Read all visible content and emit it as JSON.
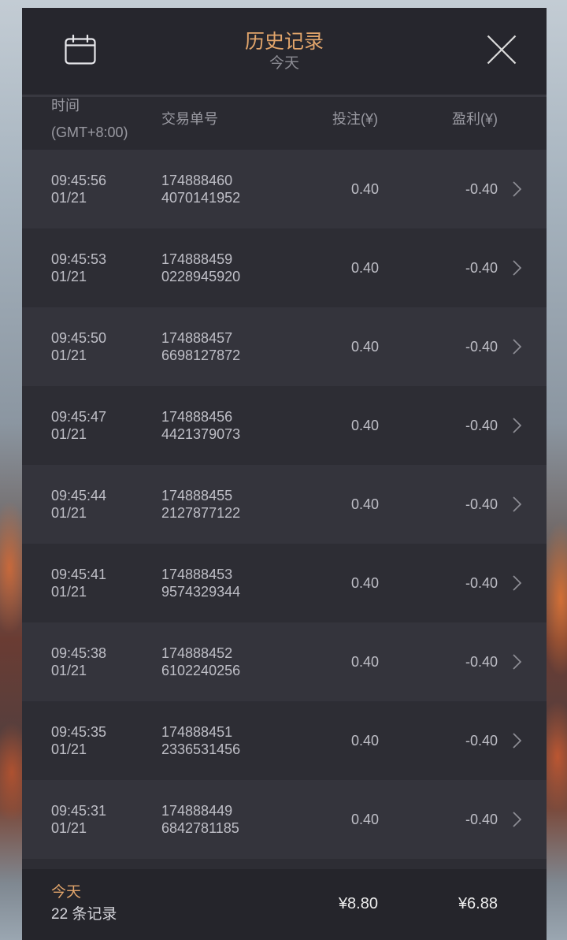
{
  "header": {
    "title": "历史记录",
    "subtitle": "今天",
    "left_icon": "calendar-icon",
    "right_icon": "close-icon"
  },
  "columns": {
    "time": "时间",
    "timezone": "(GMT+8:00)",
    "order_no": "交易单号",
    "bet": "投注(¥)",
    "profit": "盈利(¥)"
  },
  "records": [
    {
      "time": "09:45:56",
      "date": "01/21",
      "order_no": [
        "174888460",
        "4070141952"
      ],
      "bet": "0.40",
      "profit": "-0.40"
    },
    {
      "time": "09:45:53",
      "date": "01/21",
      "order_no": [
        "174888459",
        "0228945920"
      ],
      "bet": "0.40",
      "profit": "-0.40"
    },
    {
      "time": "09:45:50",
      "date": "01/21",
      "order_no": [
        "174888457",
        "6698127872"
      ],
      "bet": "0.40",
      "profit": "-0.40"
    },
    {
      "time": "09:45:47",
      "date": "01/21",
      "order_no": [
        "174888456",
        "4421379073"
      ],
      "bet": "0.40",
      "profit": "-0.40"
    },
    {
      "time": "09:45:44",
      "date": "01/21",
      "order_no": [
        "174888455",
        "2127877122"
      ],
      "bet": "0.40",
      "profit": "-0.40"
    },
    {
      "time": "09:45:41",
      "date": "01/21",
      "order_no": [
        "174888453",
        "9574329344"
      ],
      "bet": "0.40",
      "profit": "-0.40"
    },
    {
      "time": "09:45:38",
      "date": "01/21",
      "order_no": [
        "174888452",
        "6102240256"
      ],
      "bet": "0.40",
      "profit": "-0.40"
    },
    {
      "time": "09:45:35",
      "date": "01/21",
      "order_no": [
        "174888451",
        "2336531456"
      ],
      "bet": "0.40",
      "profit": "-0.40"
    },
    {
      "time": "09:45:31",
      "date": "01/21",
      "order_no": [
        "174888449",
        "6842781185"
      ],
      "bet": "0.40",
      "profit": "-0.40"
    }
  ],
  "row_icon": "chevron-right-icon",
  "footer": {
    "period": "今天",
    "count": "22 条记录",
    "total_bet": "¥8.80",
    "total_profit": "¥6.88"
  },
  "colors": {
    "accent": "#e2a56b",
    "panel": "#2b2b32",
    "header_bg": "#26262d",
    "row_light": "#34343c",
    "row_dark": "#2d2d34",
    "footer_bg": "#25252b",
    "text": "#bfbfc7",
    "muted": "#9a9aa2"
  }
}
